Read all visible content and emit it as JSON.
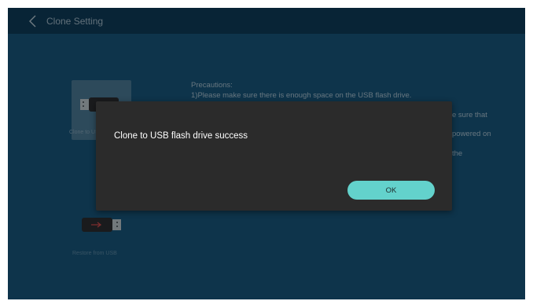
{
  "header": {
    "title": "Clone Setting",
    "back_icon": "chevron-left-icon"
  },
  "options": [
    {
      "label": "Clone to USB",
      "icon": "usb-drive-icon"
    },
    {
      "label": "Restore from USB",
      "icon": "usb-drive-icon"
    }
  ],
  "precautions": {
    "heading": "Precautions:",
    "line1": "1)Please make sure there is enough space on the USB flash drive.",
    "line2_visible": "e sure that",
    "line3_visible": "powered on",
    "line4_visible": "the"
  },
  "dialog": {
    "message": "Clone to USB flash drive success",
    "ok_label": "OK"
  },
  "colors": {
    "background": "#18557a",
    "titlebar": "#0d3a58",
    "dialog": "#2b2b2b",
    "accent": "#63d2cc"
  }
}
